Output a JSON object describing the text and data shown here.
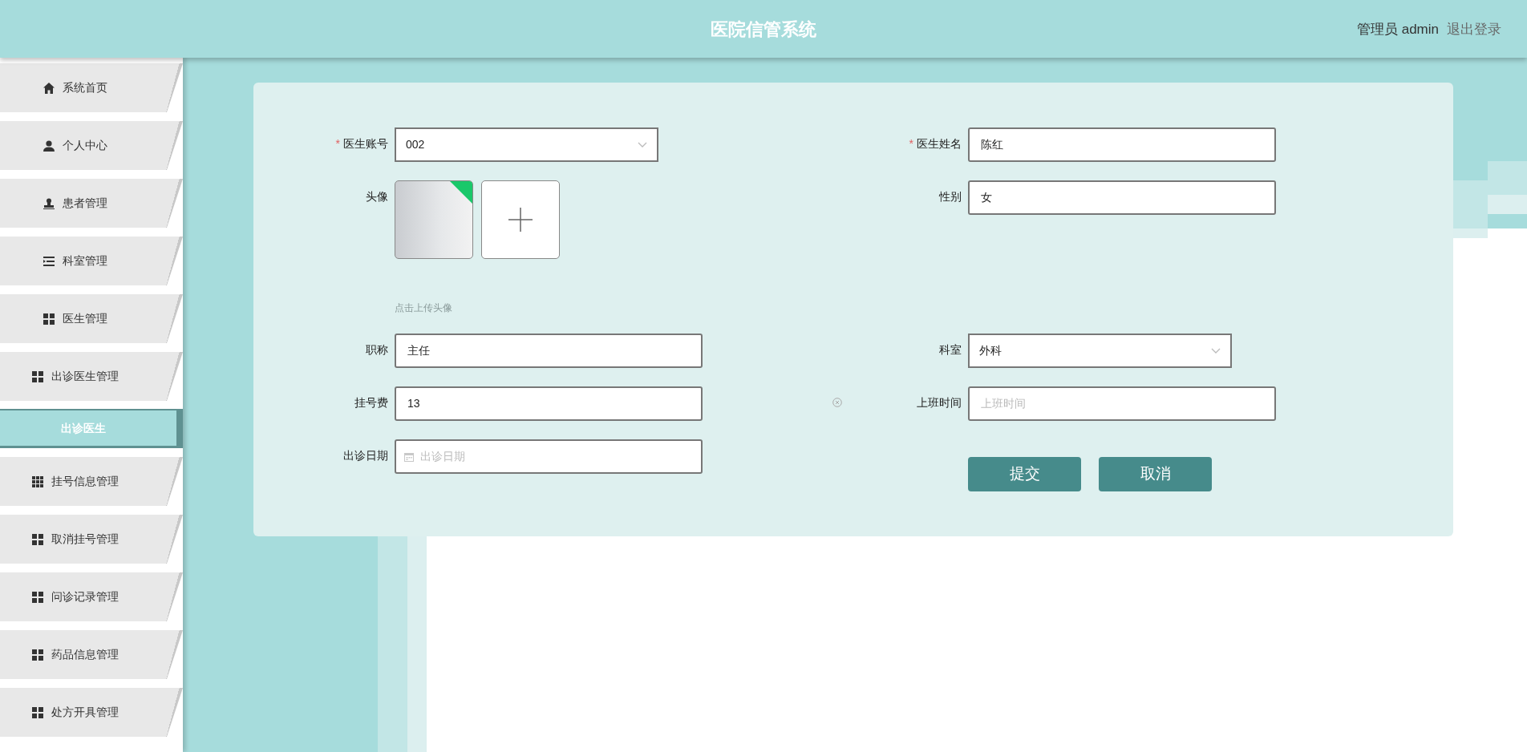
{
  "header": {
    "title": "医院信管系统",
    "user": "管理员 admin",
    "logout": "退出登录"
  },
  "sidebar": {
    "items": [
      {
        "label": "系统首页",
        "selected": false
      },
      {
        "label": "个人中心",
        "selected": false
      },
      {
        "label": "患者管理",
        "selected": false
      },
      {
        "label": "科室管理",
        "selected": false
      },
      {
        "label": "医生管理",
        "selected": false
      },
      {
        "label": "出诊医生管理",
        "selected": false
      },
      {
        "label": "出诊医生",
        "selected": true
      },
      {
        "label": "挂号信息管理",
        "selected": false
      },
      {
        "label": "取消挂号管理",
        "selected": false
      },
      {
        "label": "问诊记录管理",
        "selected": false
      },
      {
        "label": "药品信息管理",
        "selected": false
      },
      {
        "label": "处方开具管理",
        "selected": false
      }
    ]
  },
  "form": {
    "rows": [
      {
        "left": {
          "kind": "select",
          "required_mark": "*",
          "label": "医生账号",
          "value": "002"
        },
        "right": {
          "kind": "text",
          "required_mark": "*",
          "label": "医生姓名",
          "value": "陈红"
        }
      },
      {
        "left": {
          "kind": "avatar",
          "label": "头像",
          "hint": "点击上传头像"
        },
        "right": {
          "kind": "text",
          "label": "性别",
          "value": "女"
        }
      },
      {
        "left": {
          "kind": "text",
          "label": "职称",
          "value": "主任"
        },
        "right": {
          "kind": "select",
          "label": "科室",
          "value": "外科"
        }
      },
      {
        "left": {
          "kind": "text",
          "label": "挂号费",
          "value": "13"
        },
        "right": {
          "kind": "time",
          "label": "上班时间",
          "placeholder": "上班时间"
        }
      },
      {
        "left": {
          "kind": "date",
          "label": "出诊日期",
          "placeholder": "出诊日期"
        }
      }
    ],
    "buttons": [
      "提交",
      "取消"
    ]
  }
}
